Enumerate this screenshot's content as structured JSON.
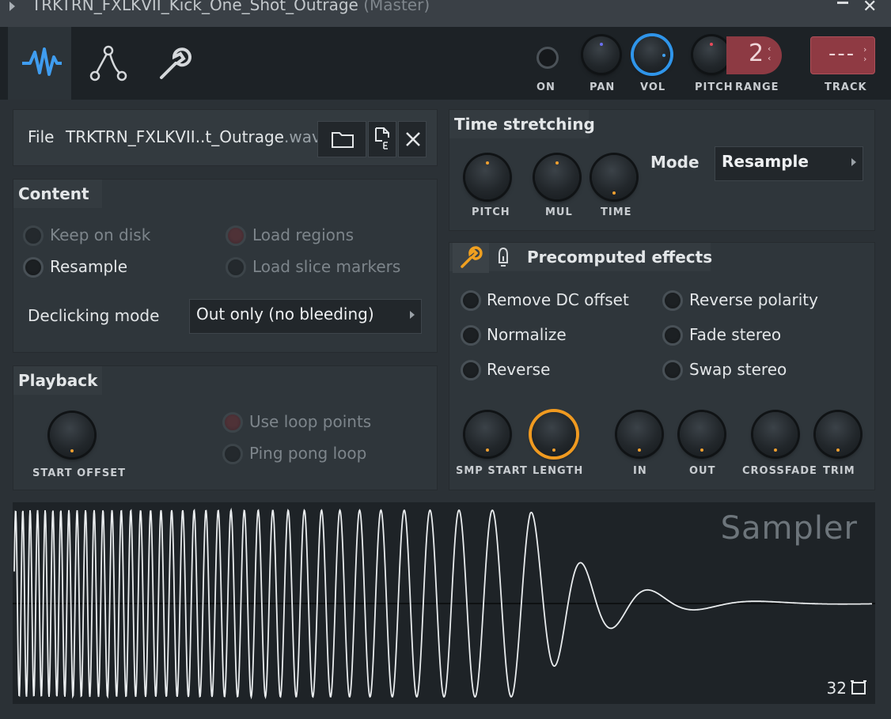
{
  "window": {
    "title": "TRKTRN_FXLKVII_Kick_One_Shot_Outrage",
    "subtitle": "(Master)"
  },
  "toolbar": {
    "tabs": [
      {
        "name": "sample-tab",
        "icon": "waveform-icon",
        "active": true
      },
      {
        "name": "envelope-tab",
        "icon": "envelope-icon",
        "active": false
      },
      {
        "name": "misc-tab",
        "icon": "wrench-icon",
        "active": false
      }
    ],
    "on_label": "ON",
    "pan_label": "PAN",
    "vol_label": "VOL",
    "pitch_label": "PITCH",
    "range_label": "RANGE",
    "range_value": "2",
    "track_label": "TRACK",
    "track_value": "---",
    "colors": {
      "vol_ring": "#2f95ea",
      "range_bg": "#8d3a43",
      "accent": "#f09a20"
    }
  },
  "file": {
    "label": "File",
    "name": "TRKTRN_FXLKVII..t_Outrage",
    "ext": ".wav"
  },
  "content": {
    "title": "Content",
    "keep_on_disk": "Keep on disk",
    "resample": "Resample",
    "load_regions": "Load regions",
    "load_slice_markers": "Load slice markers",
    "declicking_label": "Declicking mode",
    "declicking_value": "Out only (no bleeding)"
  },
  "playback": {
    "title": "Playback",
    "start_offset": "START OFFSET",
    "use_loop_points": "Use loop points",
    "ping_pong_loop": "Ping pong loop"
  },
  "time_stretching": {
    "title": "Time stretching",
    "pitch": "PITCH",
    "mul": "MUL",
    "time": "TIME",
    "mode_label": "Mode",
    "mode_value": "Resample"
  },
  "precomputed": {
    "title": "Precomputed effects",
    "remove_dc": "Remove DC offset",
    "normalize": "Normalize",
    "reverse": "Reverse",
    "reverse_polarity": "Reverse polarity",
    "fade_stereo": "Fade stereo",
    "swap_stereo": "Swap stereo",
    "knobs": {
      "smp_start": "SMP START",
      "length": "LENGTH",
      "in": "IN",
      "out": "OUT",
      "crossfade": "CROSSFADE",
      "trim": "TRIM"
    }
  },
  "waveform": {
    "brand": "Sampler",
    "zoom": "32"
  }
}
